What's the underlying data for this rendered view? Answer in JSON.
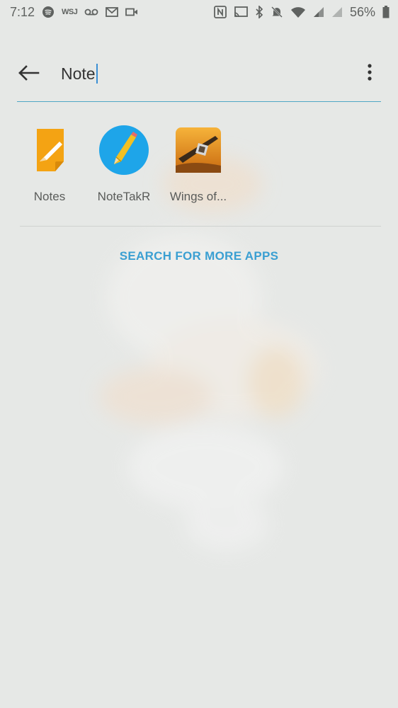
{
  "status_bar": {
    "time": "7:12",
    "carrier_badge": "WSJ",
    "battery_percent": "56%",
    "icons_left": [
      "spotify-icon",
      "wsj-icon",
      "voicemail-icon",
      "gmail-icon",
      "video-icon"
    ],
    "icons_right": [
      "nfc-icon",
      "cast-icon",
      "bluetooth-icon",
      "mute-icon",
      "wifi-icon",
      "signal-icon",
      "signal-off-icon",
      "battery-icon"
    ]
  },
  "search": {
    "query": "Note",
    "back_icon": "arrow-left-icon",
    "menu_icon": "more-vert-icon"
  },
  "results": [
    {
      "label": "Notes",
      "icon": "notes-app-icon"
    },
    {
      "label": "NoteTakR",
      "icon": "notetakr-app-icon"
    },
    {
      "label": "Wings of...",
      "icon": "wings-of-app-icon"
    }
  ],
  "more_apps_label": "SEARCH FOR MORE APPS",
  "colors": {
    "accent": "#3a9fd2",
    "background": "#e6e8e6"
  }
}
